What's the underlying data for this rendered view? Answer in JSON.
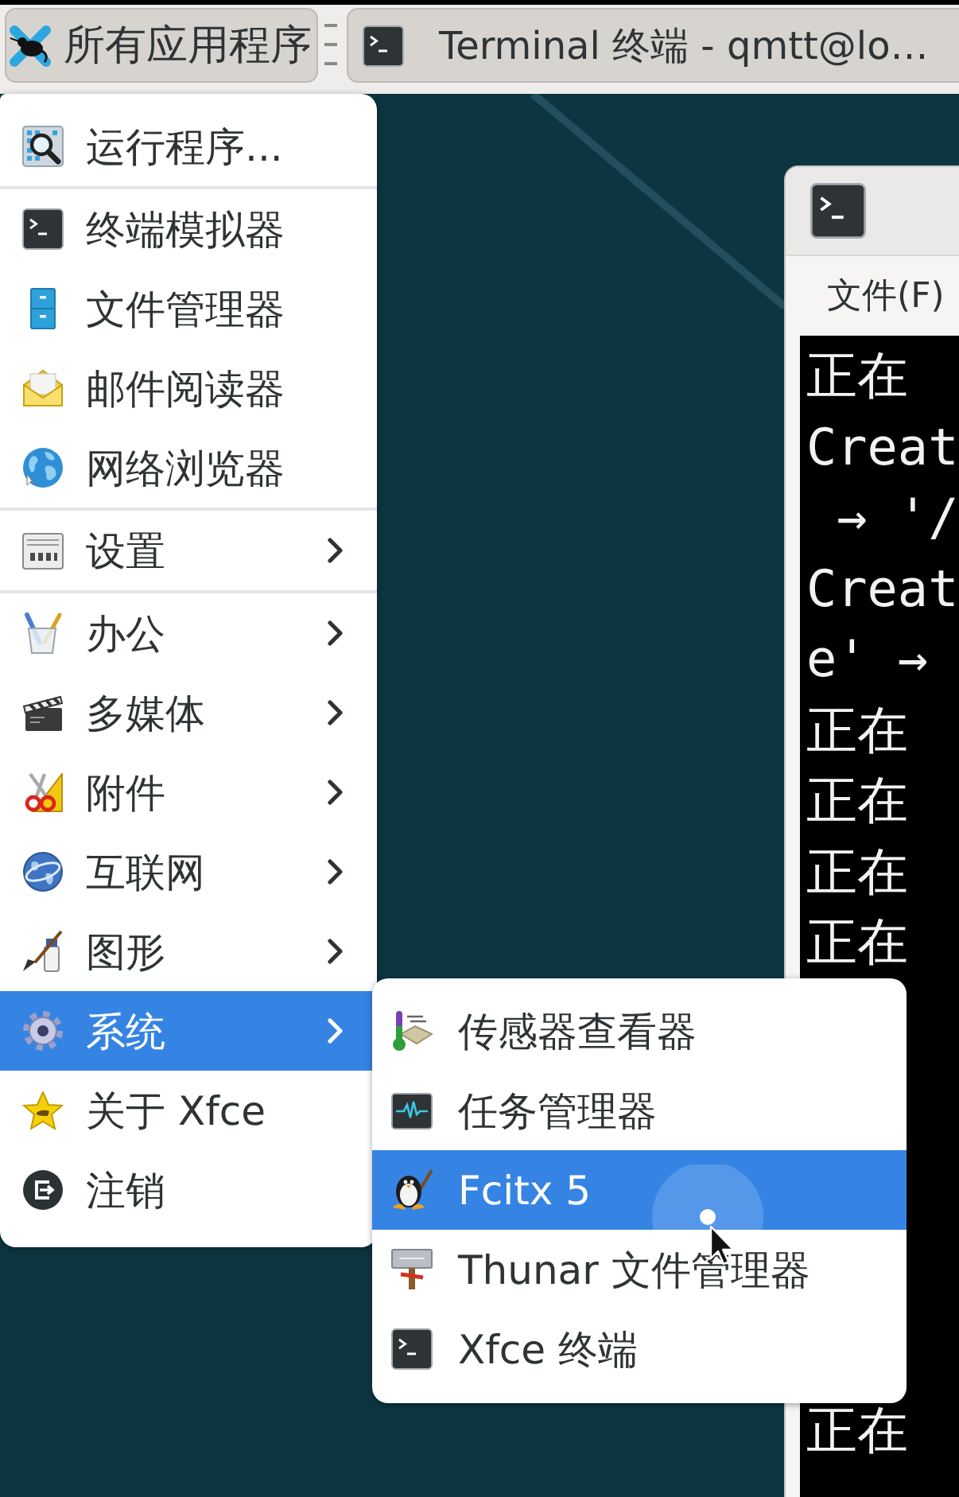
{
  "panel": {
    "apps_button": {
      "label": "所有应用程序"
    },
    "task_button": {
      "label": "Terminal 终端 - qmtt@lo…"
    }
  },
  "terminal_window": {
    "menu_bar": [
      "文件(F)"
    ],
    "output_top": [
      "正在",
      "Creat",
      " → '/",
      "Creat",
      "e' →",
      "正在",
      "正在",
      "正在",
      "正在"
    ],
    "output_bottom": [
      "正在"
    ]
  },
  "applications_menu": {
    "items": [
      {
        "kind": "launcher",
        "label": "运行程序...",
        "selected": false
      },
      {
        "kind": "separator"
      },
      {
        "kind": "launcher",
        "label": "终端模拟器",
        "selected": false
      },
      {
        "kind": "launcher",
        "label": "文件管理器",
        "selected": false
      },
      {
        "kind": "launcher",
        "label": "邮件阅读器",
        "selected": false
      },
      {
        "kind": "launcher",
        "label": "网络浏览器",
        "selected": false
      },
      {
        "kind": "separator"
      },
      {
        "kind": "category",
        "label": "设置",
        "selected": false
      },
      {
        "kind": "separator"
      },
      {
        "kind": "category",
        "label": "办公",
        "selected": false
      },
      {
        "kind": "category",
        "label": "多媒体",
        "selected": false
      },
      {
        "kind": "category",
        "label": "附件",
        "selected": false
      },
      {
        "kind": "category",
        "label": "互联网",
        "selected": false
      },
      {
        "kind": "category",
        "label": "图形",
        "selected": false
      },
      {
        "kind": "category",
        "label": "系统",
        "selected": true
      },
      {
        "kind": "launcher",
        "label": "关于 Xfce",
        "selected": false
      },
      {
        "kind": "launcher",
        "label": "注销",
        "selected": false
      }
    ]
  },
  "system_submenu": {
    "items": [
      {
        "label": "传感器查看器",
        "selected": false
      },
      {
        "label": "任务管理器",
        "selected": false
      },
      {
        "label": "Fcitx 5",
        "selected": true
      },
      {
        "label": "Thunar 文件管理器",
        "selected": false
      },
      {
        "label": "Xfce 终端",
        "selected": false
      }
    ]
  }
}
